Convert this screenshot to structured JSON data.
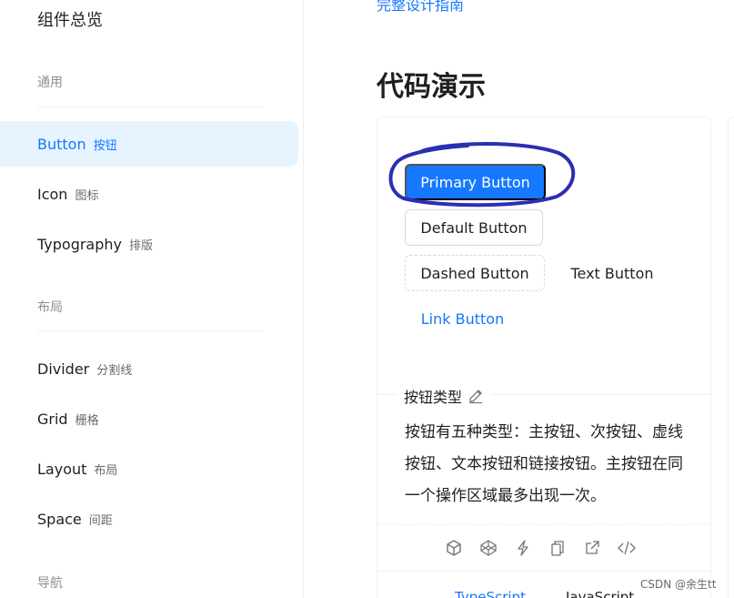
{
  "sidebar": {
    "overview": "组件总览",
    "groups": [
      {
        "title": "通用"
      },
      {
        "title": "布局"
      },
      {
        "title": "导航"
      }
    ],
    "items": [
      {
        "label": "Button",
        "sub": "按钮",
        "active": true
      },
      {
        "label": "Icon",
        "sub": "图标"
      },
      {
        "label": "Typography",
        "sub": "排版"
      },
      {
        "label": "Divider",
        "sub": "分割线"
      },
      {
        "label": "Grid",
        "sub": "栅格"
      },
      {
        "label": "Layout",
        "sub": "布局"
      },
      {
        "label": "Space",
        "sub": "间距"
      }
    ]
  },
  "main": {
    "guide_link": "完整设计指南",
    "section_title": "代码演示",
    "demo": {
      "buttons": {
        "primary": "Primary Button",
        "default": "Default Button",
        "dashed": "Dashed Button",
        "text": "Text Button",
        "link": "Link Button"
      },
      "desc_title": "按钮类型",
      "desc_text": "按钮有五种类型：主按钮、次按钮、虚线按钮、文本按钮和链接按钮。主按钮在同一个操作区域最多出现一次。",
      "action_icons": [
        "codesandbox-icon",
        "codepen-icon",
        "thunderbolt-icon",
        "copy-icon",
        "open-external-icon",
        "code-icon"
      ],
      "code_tabs": [
        "TypeScript",
        "JavaScript"
      ]
    }
  },
  "watermark": "CSDN @余生tt",
  "colors": {
    "accent": "#1677ff",
    "active_bg": "#e6f4ff",
    "annotation": "#2b2fb3"
  }
}
